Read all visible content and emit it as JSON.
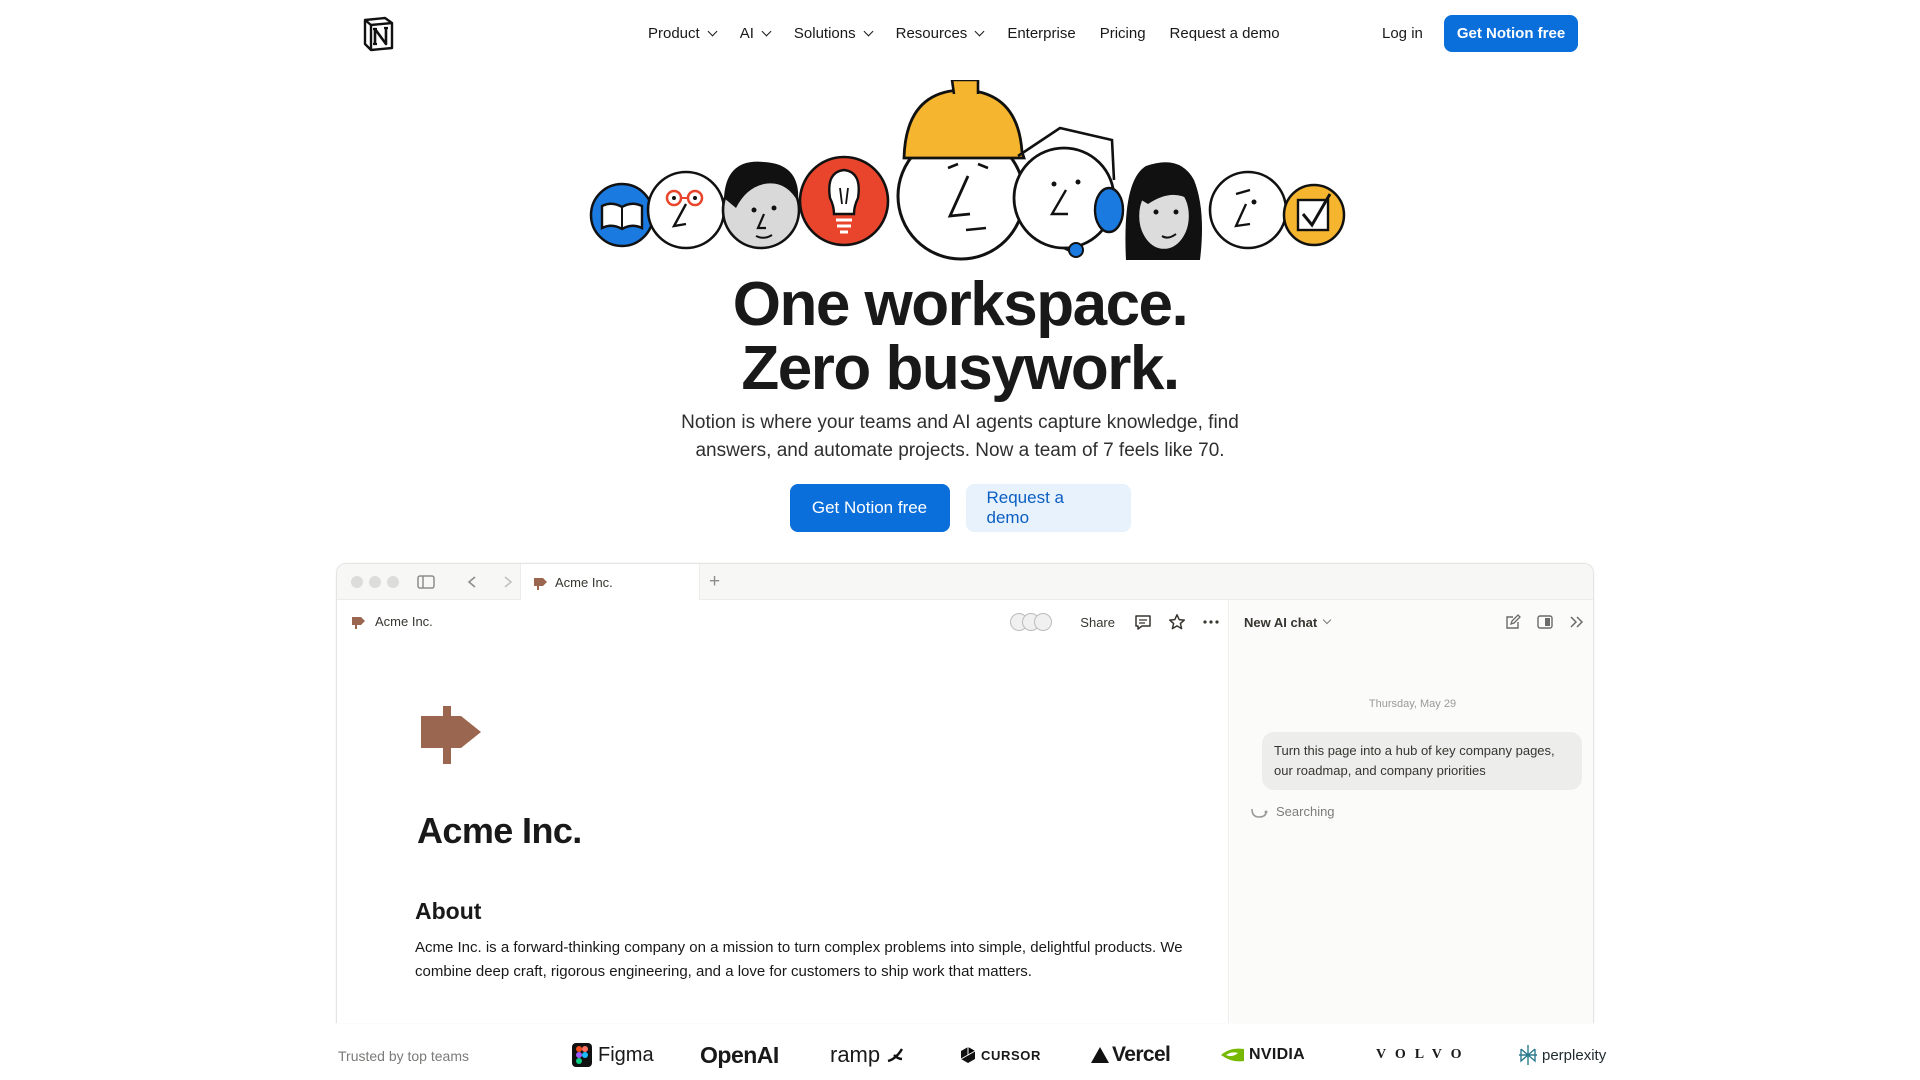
{
  "nav": {
    "links": [
      {
        "label": "Product",
        "dropdown": true
      },
      {
        "label": "AI",
        "dropdown": true
      },
      {
        "label": "Solutions",
        "dropdown": true
      },
      {
        "label": "Resources",
        "dropdown": true
      },
      {
        "label": "Enterprise",
        "dropdown": false
      },
      {
        "label": "Pricing",
        "dropdown": false
      },
      {
        "label": "Request a demo",
        "dropdown": false
      }
    ],
    "login": "Log in",
    "cta": "Get Notion free"
  },
  "hero": {
    "title_line1": "One workspace.",
    "title_line2": "Zero busywork.",
    "subtitle_line1": "Notion is where your teams and AI agents capture knowledge, find",
    "subtitle_line2": "answers, and automate projects. Now a team of 7 feels like 70.",
    "primary_cta": "Get Notion free",
    "secondary_cta": "Request a demo"
  },
  "app": {
    "tab_title": "Acme Inc.",
    "breadcrumb": "Acme Inc.",
    "share": "Share",
    "page": {
      "title": "Acme Inc.",
      "heading": "About",
      "body": "Acme Inc. is a forward-thinking company on a mission to turn complex problems into simple, delightful products. We combine deep craft, rigorous engineering, and a love for customers to ship work that matters."
    },
    "ai_chat": {
      "title": "New AI chat",
      "date": "Thursday, May 29",
      "message": "Turn this page into a hub of key company pages, our roadmap, and company priorities",
      "status": "Searching"
    }
  },
  "trusted": {
    "label": "Trusted by top teams",
    "logos": [
      "Figma",
      "OpenAI",
      "ramp",
      "CURSOR",
      "Vercel",
      "NVIDIA",
      "VOLVO",
      "perplexity"
    ]
  },
  "colors": {
    "accent": "#0b6fdb",
    "accent_light": "#e8f2fd",
    "signpost": "#9a6650",
    "helmet": "#f5b52e",
    "bulb_red": "#e8452c",
    "book_blue": "#1a7ae0"
  }
}
